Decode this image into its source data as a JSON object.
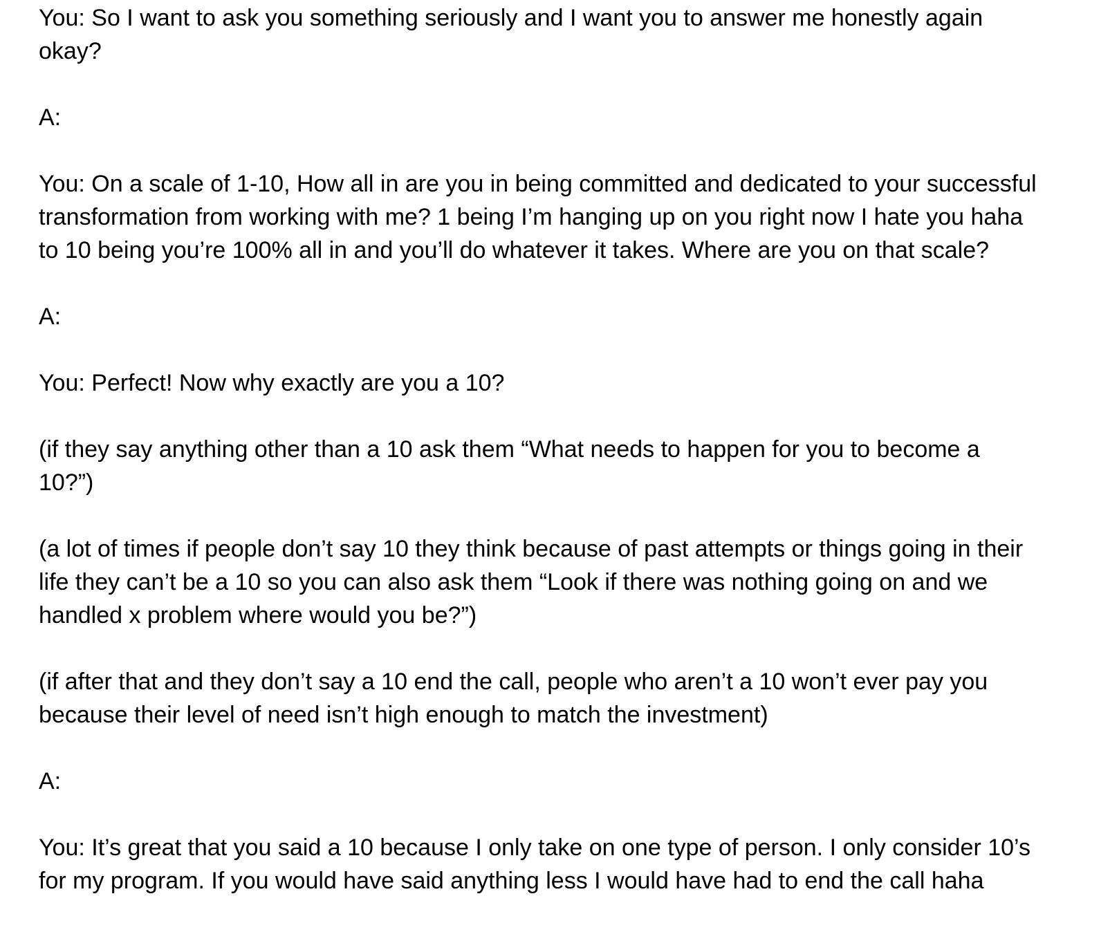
{
  "document": {
    "blocks": [
      {
        "id": "p1",
        "lines": [
          "You: So I want to ask you something seriously and I want you to answer me honestly again",
          "okay?"
        ]
      },
      {
        "id": "a1",
        "lines": [
          "A:"
        ]
      },
      {
        "id": "p2",
        "lines": [
          "You: On a scale of 1-10, How all in are you in being committed and dedicated to your successful",
          "transformation from working with me? 1 being I’m hanging up on you right now I hate you haha",
          "to 10 being you’re 100% all in and you’ll do whatever it takes. Where are you on that scale?"
        ]
      },
      {
        "id": "a2",
        "lines": [
          "A:"
        ]
      },
      {
        "id": "p3",
        "lines": [
          "You: Perfect! Now why exactly are you a 10?"
        ]
      },
      {
        "id": "n1",
        "lines": [
          "(if they say anything other than a 10 ask them “What needs to happen for you to become a",
          "10?”)"
        ]
      },
      {
        "id": "n2",
        "lines": [
          "(a lot of times if people don’t say 10 they think because of past attempts or things going in their",
          "life they can’t be a 10 so you can also ask them “Look if there was nothing going on and we",
          "handled x problem where would you be?”)"
        ]
      },
      {
        "id": "n3",
        "lines": [
          "(if after that and they don’t say a 10 end the call, people who aren’t a 10 won’t ever pay you",
          "because their level of need isn’t high enough to match the investment)"
        ]
      },
      {
        "id": "a3",
        "lines": [
          "A:"
        ]
      },
      {
        "id": "p4",
        "lines": [
          "You: It’s great that you said a 10 because I only take on one type of person. I only consider 10’s",
          "for my program. If you would have said anything less I would have had to end the call haha"
        ]
      }
    ]
  }
}
